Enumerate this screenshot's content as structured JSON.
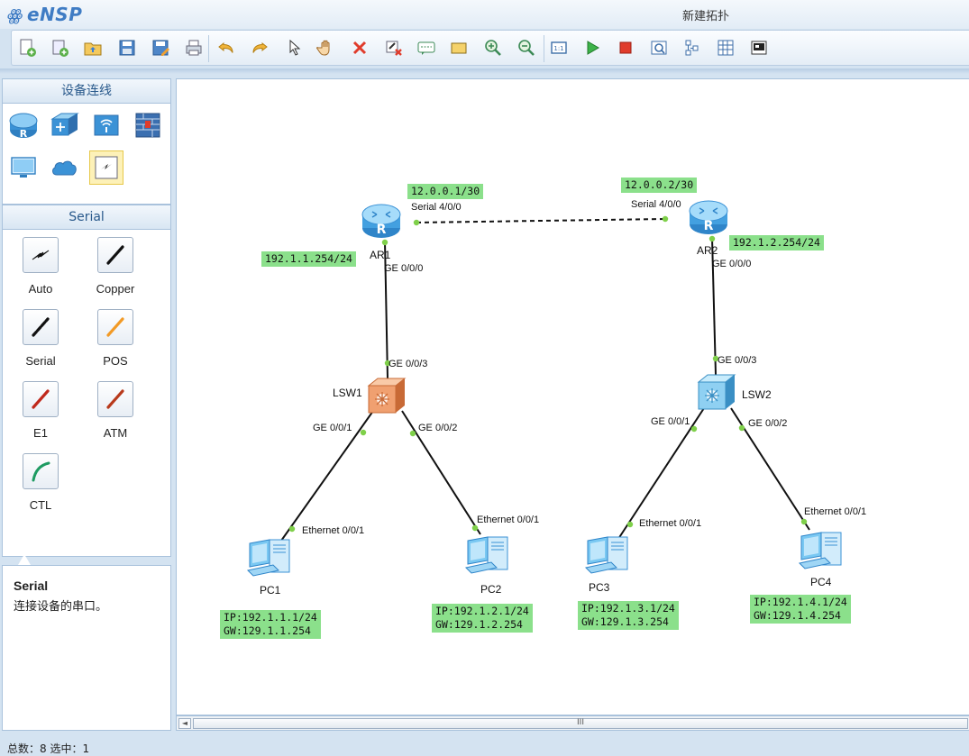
{
  "app": {
    "name": "eNSP",
    "window_title": "新建拓扑"
  },
  "toolbar": {
    "buttons": [
      {
        "icon": "new-topology-icon"
      },
      {
        "icon": "new-example-icon"
      },
      {
        "icon": "open-icon"
      },
      {
        "icon": "save-icon"
      },
      {
        "icon": "save-as-icon"
      },
      {
        "icon": "print-icon"
      },
      {
        "icon": "undo-icon"
      },
      {
        "icon": "redo-icon"
      },
      {
        "icon": "select-pointer-icon"
      },
      {
        "icon": "hand-pan-icon"
      },
      {
        "icon": "delete-icon"
      },
      {
        "icon": "delete-link-icon"
      },
      {
        "icon": "text-note-icon"
      },
      {
        "icon": "rectangle-note-icon"
      },
      {
        "icon": "zoom-in-icon"
      },
      {
        "icon": "zoom-out-icon"
      },
      {
        "icon": "topology-fit-icon"
      },
      {
        "icon": "start-device-icon"
      },
      {
        "icon": "stop-device-icon"
      },
      {
        "icon": "capture-icon"
      },
      {
        "icon": "topology-view-icon"
      },
      {
        "icon": "grid-icon"
      },
      {
        "icon": "screenshot-icon"
      }
    ]
  },
  "left_panel": {
    "devices_header": "设备连线",
    "device_categories": [
      {
        "icon": "router-icon"
      },
      {
        "icon": "switch-icon"
      },
      {
        "icon": "wlan-icon"
      },
      {
        "icon": "firewall-icon"
      },
      {
        "icon": "terminal-pc-icon"
      },
      {
        "icon": "cloud-icon"
      },
      {
        "icon": "cable-icon",
        "selected": true
      }
    ],
    "cables_header": "Serial",
    "cables": [
      {
        "label": "Auto",
        "icon": "auto-cable-icon",
        "color": "#111111"
      },
      {
        "label": "Copper",
        "icon": "copper-cable-icon",
        "color": "#111111"
      },
      {
        "label": "Serial",
        "icon": "serial-cable-icon",
        "color": "#111111"
      },
      {
        "label": "POS",
        "icon": "pos-cable-icon",
        "color": "#f29a26"
      },
      {
        "label": "E1",
        "icon": "e1-cable-icon",
        "color": "#c0291c"
      },
      {
        "label": "ATM",
        "icon": "atm-cable-icon",
        "color": "#b83a1c"
      },
      {
        "label": "CTL",
        "icon": "ctl-cable-icon",
        "color": "#1e9b62"
      }
    ],
    "description": {
      "title": "Serial",
      "text": "连接设备的串口。"
    }
  },
  "topology": {
    "devices": [
      {
        "id": "AR1",
        "name": "AR1",
        "type": "router"
      },
      {
        "id": "AR2",
        "name": "AR2",
        "type": "router"
      },
      {
        "id": "LSW1",
        "name": "LSW1",
        "type": "switch",
        "color": "#f0a070"
      },
      {
        "id": "LSW2",
        "name": "LSW2",
        "type": "switch",
        "color": "#8fd0f2"
      },
      {
        "id": "PC1",
        "name": "PC1",
        "type": "pc"
      },
      {
        "id": "PC2",
        "name": "PC2",
        "type": "pc"
      },
      {
        "id": "PC3",
        "name": "PC3",
        "type": "pc"
      },
      {
        "id": "PC4",
        "name": "PC4",
        "type": "pc"
      }
    ],
    "port_labels": {
      "ar1_serial": "Serial 4/0/0",
      "ar2_serial": "Serial 4/0/0",
      "ar1_ge": "GE 0/0/0",
      "ar2_ge": "GE 0/0/0",
      "lsw1_up": "GE 0/0/3",
      "lsw2_up": "GE 0/0/3",
      "lsw1_p1": "GE 0/0/1",
      "lsw1_p2": "GE 0/0/2",
      "lsw2_p1": "GE 0/0/1",
      "lsw2_p2": "GE 0/0/2",
      "pc1_eth": "Ethernet 0/0/1",
      "pc2_eth": "Ethernet 0/0/1",
      "pc3_eth": "Ethernet 0/0/1",
      "pc4_eth": "Ethernet 0/0/1"
    },
    "notes": {
      "ar1_serial_ip": "12.0.0.1/30",
      "ar2_serial_ip": "12.0.0.2/30",
      "ar1_lan_ip": "192.1.1.254/24",
      "ar2_lan_ip": "192.1.2.254/24",
      "pc1": {
        "ip": "IP:192.1.1.1/24",
        "gw": "GW:129.1.1.254"
      },
      "pc2": {
        "ip": "IP:192.1.2.1/24",
        "gw": "GW:129.1.2.254"
      },
      "pc3": {
        "ip": "IP:192.1.3.1/24",
        "gw": "GW:129.1.3.254"
      },
      "pc4": {
        "ip": "IP:192.1.4.1/24",
        "gw": "GW:129.1.4.254"
      }
    },
    "note_color": "#8be08b",
    "link_dot_color": "#7fd04a"
  },
  "scrollbar": {
    "thumb_grip": "III"
  },
  "status": {
    "text": "总数：8  选中：1"
  }
}
